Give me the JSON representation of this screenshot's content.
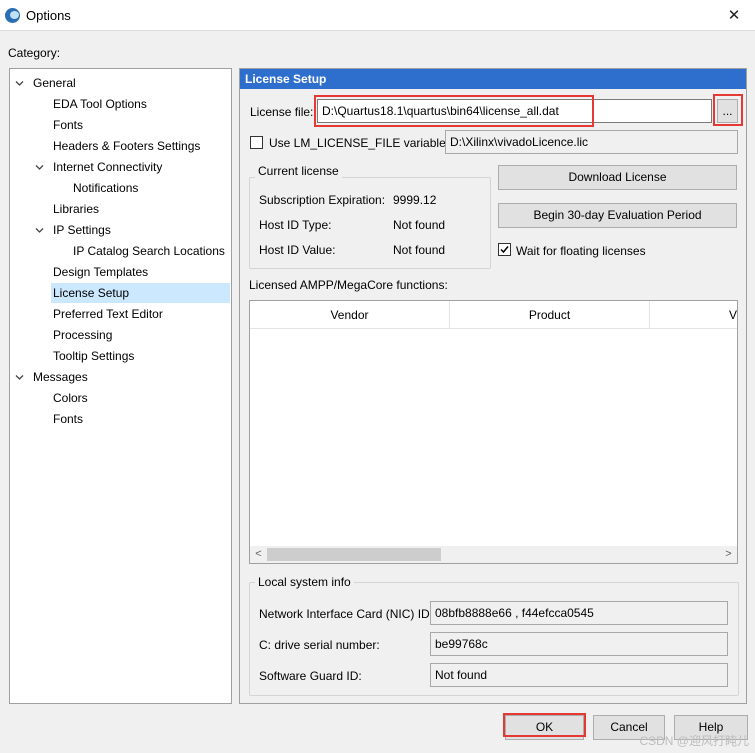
{
  "window": {
    "title": "Options",
    "close_glyph": "✕",
    "app_icon": "quartus-logo-icon"
  },
  "category_label": "Category:",
  "tree": [
    {
      "label": "General",
      "level": 0,
      "expanded": true
    },
    {
      "label": "EDA Tool Options",
      "level": 1
    },
    {
      "label": "Fonts",
      "level": 1
    },
    {
      "label": "Headers & Footers Settings",
      "level": 1
    },
    {
      "label": "Internet Connectivity",
      "level": 1,
      "expanded": true
    },
    {
      "label": "Notifications",
      "level": 2
    },
    {
      "label": "Libraries",
      "level": 1
    },
    {
      "label": "IP Settings",
      "level": 1,
      "expanded": true
    },
    {
      "label": "IP Catalog Search Locations",
      "level": 2
    },
    {
      "label": "Design Templates",
      "level": 1
    },
    {
      "label": "License Setup",
      "level": 1,
      "selected": true
    },
    {
      "label": "Preferred Text Editor",
      "level": 1
    },
    {
      "label": "Processing",
      "level": 1
    },
    {
      "label": "Tooltip Settings",
      "level": 1
    },
    {
      "label": "Messages",
      "level": 0,
      "expanded": true
    },
    {
      "label": "Colors",
      "level": 1
    },
    {
      "label": "Fonts",
      "level": 1
    }
  ],
  "panel": {
    "header": "License Setup",
    "license_file_label": "License file:",
    "license_file_value": "D:\\Quartus18.1\\quartus\\bin64\\license_all.dat",
    "browse_label": "...",
    "use_lm_label": "Use LM_LICENSE_FILE variable:",
    "use_lm_checked": false,
    "lm_value": "D:\\Xilinx\\vivadoLicence.lic",
    "current_license": {
      "title": "Current license",
      "rows": [
        {
          "label": "Subscription Expiration:",
          "value": "9999.12"
        },
        {
          "label": "Host ID Type:",
          "value": "Not found"
        },
        {
          "label": "Host ID Value:",
          "value": "Not found"
        }
      ]
    },
    "download_button": "Download License",
    "evaluation_button": "Begin 30-day Evaluation Period",
    "wait_floating_label": "Wait for floating licenses",
    "wait_floating_checked": true,
    "ampp_label": "Licensed AMPP/MegaCore functions:",
    "table_columns": [
      "Vendor",
      "Product",
      "V"
    ],
    "local_info": {
      "title": "Local system info",
      "rows": [
        {
          "label": "Network Interface Card (NIC) ID:",
          "value": "08bfb8888e66 , f44efcca0545"
        },
        {
          "label": "C: drive serial number:",
          "value": "be99768c"
        },
        {
          "label": "Software Guard ID:",
          "value": "Not found"
        }
      ]
    }
  },
  "buttons": {
    "ok": "OK",
    "cancel": "Cancel",
    "help": "Help"
  },
  "watermark": "CSDN @迎风打盹儿",
  "highlight_color": "#e53935",
  "selection_color": "#cce8ff",
  "header_color": "#2e6fce"
}
